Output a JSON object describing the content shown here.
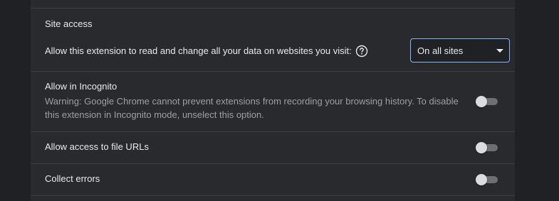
{
  "site_access": {
    "heading": "Site access",
    "label": "Allow this extension to read and change all your data on websites you visit:",
    "help_icon": "help-circle-icon",
    "select_value": "On all sites"
  },
  "incognito": {
    "title": "Allow in Incognito",
    "warning_line1": "Warning: Google Chrome cannot prevent extensions from recording your browsing history. To disable",
    "warning_line2": "this extension in Incognito mode, unselect this option.",
    "enabled": false
  },
  "file_urls": {
    "title": "Allow access to file URLs",
    "enabled": false
  },
  "collect_errors": {
    "title": "Collect errors",
    "enabled": false
  },
  "colors": {
    "background": "#202124",
    "card": "#292a2d",
    "divider": "#3c4043",
    "primary_text": "#e8eaed",
    "secondary_text": "#9aa0a6",
    "accent": "#8ab4f8"
  }
}
